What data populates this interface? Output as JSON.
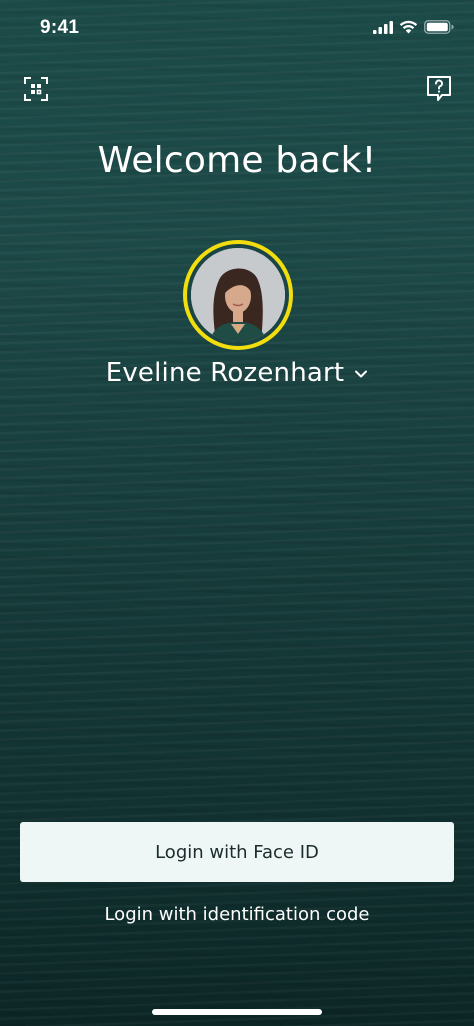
{
  "status_bar": {
    "time": "9:41",
    "icons": [
      "cellular-signal-icon",
      "wifi-icon",
      "battery-icon"
    ]
  },
  "header": {
    "left_icon": "qr-scan-icon",
    "right_icon": "help-chat-icon"
  },
  "main": {
    "title": "Welcome back!",
    "user": {
      "name": "Eveline Rozenhart",
      "dropdown_icon": "chevron-down-icon"
    }
  },
  "actions": {
    "primary_label": "Login with Face ID",
    "secondary_label": "Login with identification code"
  },
  "colors": {
    "background": "#1b4a47",
    "avatar_ring": "#f2de0f",
    "button_bg": "#eef7f6",
    "button_text": "#1c2b2b",
    "text": "#ffffff"
  }
}
